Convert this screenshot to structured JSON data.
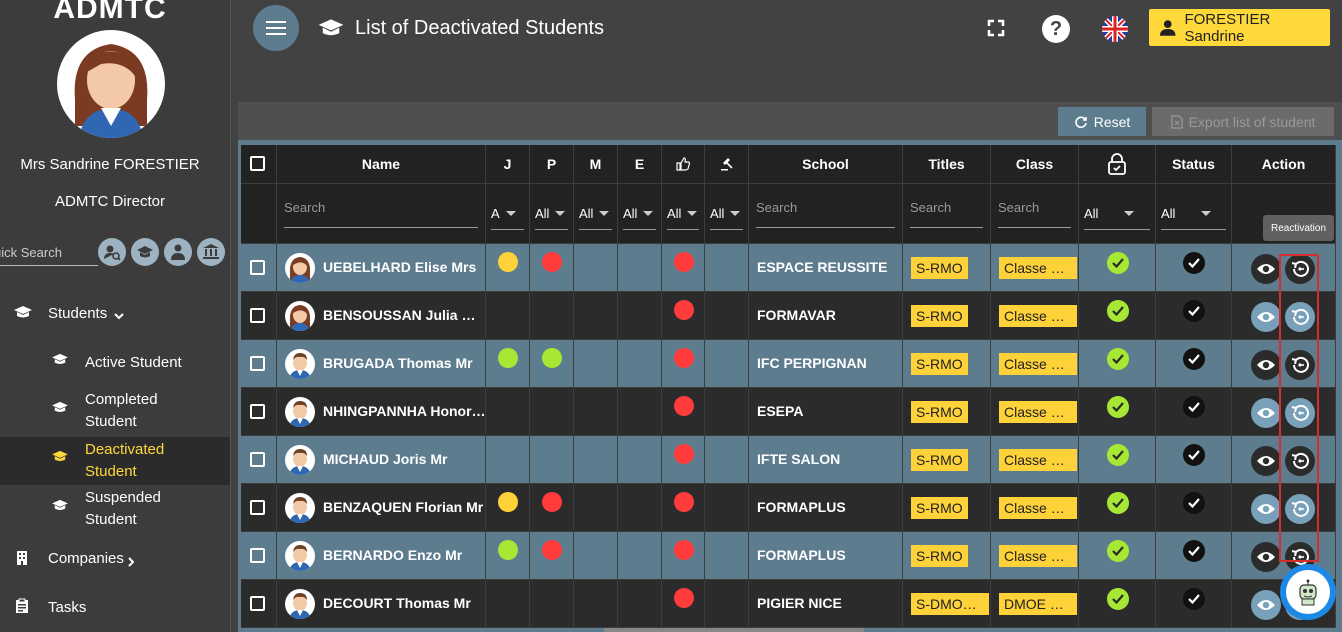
{
  "sidebar": {
    "brand": "ADMTC",
    "user_name": "Mrs Sandrine FORESTIER",
    "user_role": "ADMTC Director",
    "quick_search_placeholder": "uick Search",
    "nav": {
      "students": "Students",
      "active_student_line1": "Active Student",
      "completed_line1": "Completed",
      "completed_line2": "Student",
      "deactivated_line1": "Deactivated",
      "deactivated_line2": "Student",
      "suspended_line1": "Suspended",
      "suspended_line2": "Student",
      "companies": "Companies",
      "tasks": "Tasks"
    }
  },
  "topbar": {
    "title": "List of Deactivated Students",
    "user_button": "FORESTIER Sandrine",
    "help": "?"
  },
  "toolbar": {
    "reset": "Reset",
    "export": "Export list of student"
  },
  "table": {
    "headers": {
      "name": "Name",
      "j": "J",
      "p": "P",
      "m": "M",
      "e": "E",
      "school": "School",
      "titles": "Titles",
      "class": "Class",
      "status": "Status",
      "action": "Action"
    },
    "filters": {
      "search": "Search",
      "j": "A",
      "p": "All",
      "m": "All",
      "e": "All",
      "thumb": "All",
      "gavel": "All",
      "lock": "All",
      "status": "All"
    },
    "rows": [
      {
        "name": "UEBELHARD Elise Mrs",
        "gender": "f",
        "j": "yellow",
        "p": "red",
        "thumb": "red",
        "school": "ESPACE REUSSITE",
        "title": "S-RMO",
        "class": "Classe R..."
      },
      {
        "name": "BENSOUSSAN Julia Mrs",
        "gender": "f",
        "j": "",
        "p": "",
        "thumb": "red",
        "school": "FORMAVAR",
        "title": "S-RMO",
        "class": "Classe R..."
      },
      {
        "name": "BRUGADA Thomas Mr",
        "gender": "m",
        "j": "lime",
        "p": "lime",
        "thumb": "red",
        "school": "IFC PERPIGNAN",
        "title": "S-RMO",
        "class": "Classe R..."
      },
      {
        "name": "NHINGPANNHA Honoré ...",
        "gender": "m",
        "j": "",
        "p": "",
        "thumb": "red",
        "school": "ESEPA",
        "title": "S-RMO",
        "class": "Classe R..."
      },
      {
        "name": "MICHAUD Joris Mr",
        "gender": "m",
        "j": "",
        "p": "",
        "thumb": "red",
        "school": "IFTE SALON",
        "title": "S-RMO",
        "class": "Classe R..."
      },
      {
        "name": "BENZAQUEN Florian Mr",
        "gender": "m",
        "j": "yellow",
        "p": "red",
        "thumb": "red",
        "school": "FORMAPLUS",
        "title": "S-RMO",
        "class": "Classe R..."
      },
      {
        "name": "BERNARDO Enzo Mr",
        "gender": "m",
        "j": "lime",
        "p": "red",
        "thumb": "red",
        "school": "FORMAPLUS",
        "title": "S-RMO",
        "class": "Classe R..."
      },
      {
        "name": "DECOURT Thomas Mr",
        "gender": "m",
        "j": "",
        "p": "",
        "thumb": "red",
        "school": "PIGIER NICE",
        "title": "S-DMOE P...",
        "class": "DMOE PIG..."
      }
    ]
  },
  "tooltip": "Reactivation",
  "colors": {
    "accent": "#ffd83a",
    "steel": "#5d7d8f",
    "red": "#ff3b3b",
    "lime": "#a7e834",
    "yellow": "#ffd23a"
  }
}
